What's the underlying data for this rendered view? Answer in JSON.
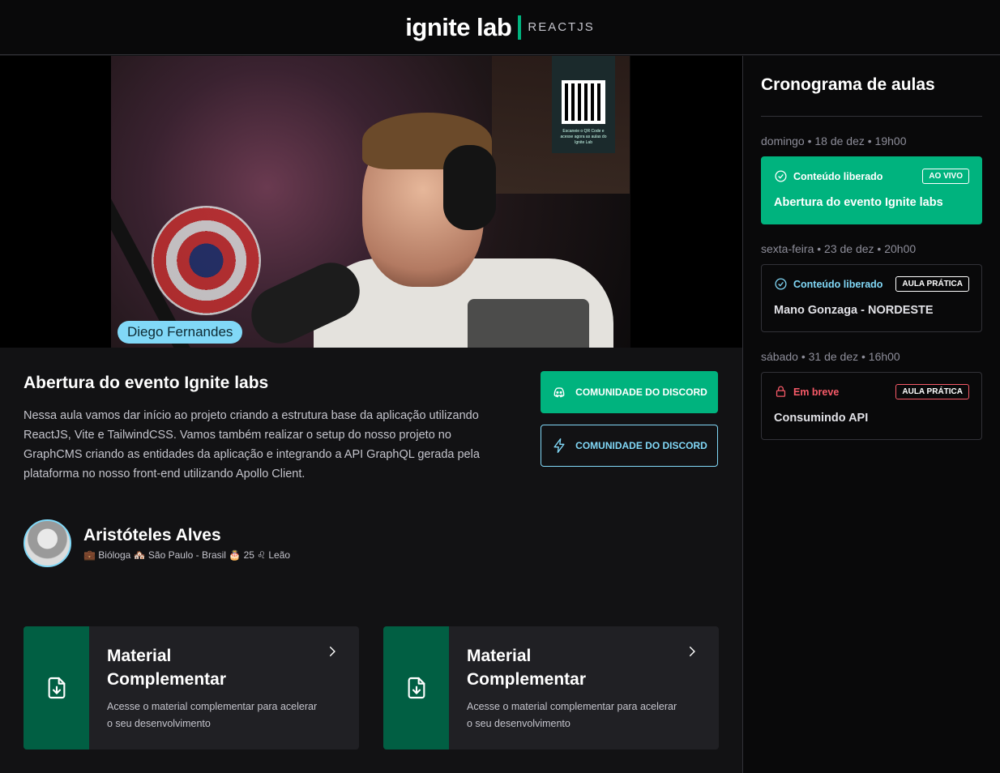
{
  "header": {
    "logo_main": "ignite lab",
    "logo_sub": "REACTJS"
  },
  "video": {
    "speaker_tag": "Diego Fernandes",
    "qr_caption": "Escaneie o QR Code e acesse agora as aulas do Ignite Lab"
  },
  "lesson": {
    "title": "Abertura do evento Ignite labs",
    "description": "Nessa aula vamos dar início ao projeto criando a estrutura base da aplicação utilizando ReactJS, Vite e TailwindCSS. Vamos também realizar o setup do nosso projeto no GraphCMS criando as entidades da aplicação e integrando a API GraphQL gerada pela plataforma no nosso front-end utilizando Apollo Client."
  },
  "buttons": {
    "discord_primary": "COMUNIDADE DO DISCORD",
    "discord_secondary": "COMUNIDADE DO DISCORD"
  },
  "teacher": {
    "name": "Aristóteles Alves",
    "meta": "💼 Bióloga 🏘️ São Paulo - Brasil 🎂 25 ♌ Leão"
  },
  "cards": [
    {
      "title": "Material Complementar",
      "text": "Acesse o material complementar para acelerar o seu desenvolvimento"
    },
    {
      "title": "Material Complementar",
      "text": "Acesse o material complementar para acelerar o seu desenvolvimento"
    }
  ],
  "sidebar": {
    "title": "Cronograma de aulas",
    "lessons": [
      {
        "date": "domingo • 18 de dez • 19h00",
        "status": "Conteúdo liberado",
        "badge": "AO VIVO",
        "name": "Abertura do evento Ignite labs",
        "active": true
      },
      {
        "date": "sexta-feira • 23 de dez • 20h00",
        "status": "Conteúdo liberado",
        "badge": "AULA PRÁTICA",
        "name": "Mano Gonzaga - NORDESTE",
        "active": false
      },
      {
        "date": "sábado • 31 de dez • 16h00",
        "status": "Em breve",
        "badge": "AULA PRÁTICA",
        "name": "Consumindo API",
        "active": false
      }
    ]
  },
  "colors": {
    "green": "#00b37e",
    "blue": "#81d8f7",
    "red": "#f75a68",
    "dark_green": "#015f43"
  }
}
